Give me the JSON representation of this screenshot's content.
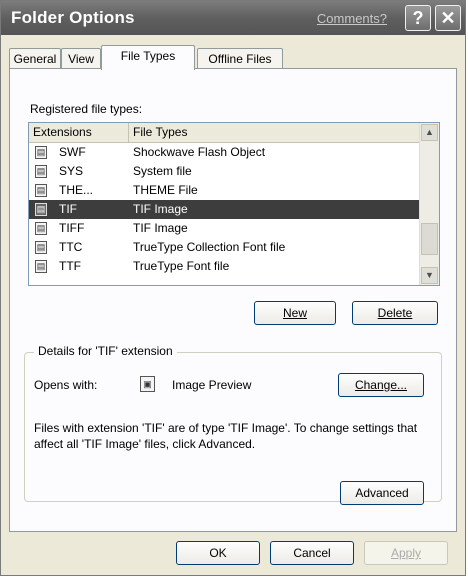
{
  "window": {
    "title": "Folder Options",
    "comments_link": "Comments?",
    "help_glyph": "?",
    "close_glyph": "✕"
  },
  "tabs": [
    {
      "label": "General"
    },
    {
      "label": "View"
    },
    {
      "label": "File Types"
    },
    {
      "label": "Offline Files"
    }
  ],
  "registered": {
    "label": "Registered file types:",
    "columns": [
      "Extensions",
      "File Types"
    ],
    "rows": [
      {
        "ext": "SWF",
        "type": "Shockwave Flash Object"
      },
      {
        "ext": "SYS",
        "type": "System file"
      },
      {
        "ext": "THE...",
        "type": "THEME File"
      },
      {
        "ext": "TIF",
        "type": "TIF Image"
      },
      {
        "ext": "TIFF",
        "type": "TIF Image"
      },
      {
        "ext": "TTC",
        "type": "TrueType Collection Font file"
      },
      {
        "ext": "TTF",
        "type": "TrueType Font file"
      }
    ],
    "selected_index": 3
  },
  "list_buttons": {
    "new": "New",
    "delete": "Delete"
  },
  "details": {
    "title": "Details for 'TIF' extension",
    "opens_with_label": "Opens with:",
    "app_name": "Image Preview",
    "change_button": "Change...",
    "description": "Files with extension 'TIF' are of type 'TIF Image'. To change settings that affect all 'TIF Image' files, click Advanced.",
    "advanced_button": "Advanced"
  },
  "footer": {
    "ok": "OK",
    "cancel": "Cancel",
    "apply": "Apply"
  }
}
